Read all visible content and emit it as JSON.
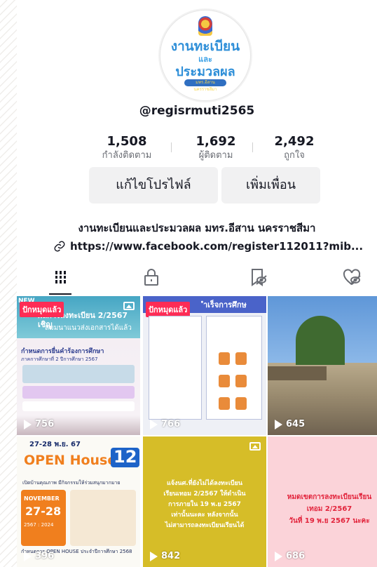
{
  "profile": {
    "logo": {
      "line1": "งานทะเบียน",
      "line2": "และ",
      "line3": "ประมวลผล",
      "strip": "มทร.อีสาน นครราชสีมา"
    },
    "username": "@regisrmuti2565",
    "stats": [
      {
        "value": "1,508",
        "label": "กำลังติดตาม"
      },
      {
        "value": "1,692",
        "label": "ผู้ติดตาม"
      },
      {
        "value": "2,492",
        "label": "ถูกใจ"
      }
    ],
    "edit_profile_label": "แก้ไขโปรไฟล์",
    "add_friend_label": "เพิ่มเพื่อน",
    "bio": "งานทะเบียนและประมวลผล มทร.อีสาน นครราชสีมา",
    "link": "https://www.facebook.com/register112011?mib..."
  },
  "tabs": [
    {
      "icon": "videos-grid-icon",
      "active": true
    },
    {
      "icon": "private-lock-icon",
      "active": false
    },
    {
      "icon": "saved-hidden-icon",
      "active": false
    },
    {
      "icon": "liked-hidden-icon",
      "active": false
    }
  ],
  "videos": [
    {
      "views": "756",
      "badge": "ปักหมุดแล้ว",
      "new_label": "NEW",
      "headline": "ผลการลงทะเบียน 2/2567 เชิญ",
      "headline2": "สัมมนาแนวส่งเอกสารได้แล้ว",
      "subhead": "กำหนดการยื่นคำร้องการศึกษา",
      "subhead2": "ภาคการศึกษาที่ 2 ปีการศึกษา 2567"
    },
    {
      "views": "766",
      "badge": "ปักหมุดแล้ว",
      "headline": "ำเร็จการศึกษ"
    },
    {
      "views": "645"
    },
    {
      "views": "396",
      "date": "27-28 พ.ย. 67",
      "title": "OPEN House",
      "number": "12",
      "caption": "เปิดบ้านคุณภาพ มีกิจกรรมให้ร่วมสนุกมากมาย",
      "month": "NOVEMBER",
      "days": "27-28",
      "year": "2567 : 2024",
      "footer": "กำหนดการ OPEN HOUSE ประจำปีการศึกษา 2568"
    },
    {
      "views": "842",
      "lines": [
        "แจ้งนศ.ที่ยังไม่ได้ลงทะเบียน",
        "เรียนเทอม 2/2567 ให้ดำเนิน",
        "การภายใน 19 พ.ย 2567",
        "เท่านั้นนะคะ หลังจากนั้น",
        "ไม่สามารถลงทะเบียนเรียนได้"
      ]
    },
    {
      "views": "686",
      "lines": [
        "หมดเขตการลงทะเบียนเรียน",
        "เทอม 2/2567",
        "วันที่ 19 พ.ย 2567 นะคะ"
      ]
    }
  ],
  "colors": {
    "accent": "#fe2c55",
    "text": "#161823",
    "muted": "#6a6d74",
    "button_bg": "#f1f1f2",
    "tile_yellow": "#d6bd28",
    "tile_pink": "#fbd3d9"
  }
}
